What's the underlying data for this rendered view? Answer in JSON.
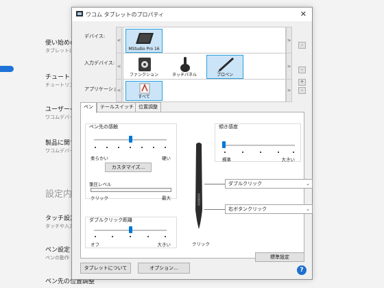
{
  "background": {
    "items": [
      {
        "title": "使い始めの",
        "sub": "タブレットに"
      },
      {
        "title": "チュートリア",
        "sub": "チュートリアル"
      },
      {
        "title": "ユーザーヘル",
        "sub": "ワコムデバイ"
      },
      {
        "title": "製品に関す",
        "sub": "ワコムデバイ"
      }
    ],
    "section_title": "設定内",
    "items2": [
      {
        "title": "タッチ設定",
        "sub": "タッチや入力"
      },
      {
        "title": "ペン設定",
        "sub": "ペンの動作"
      },
      {
        "title": "ペン先の位置調整",
        "sub": ""
      }
    ]
  },
  "dialog": {
    "title": "ワコム タブレットのプロパティ",
    "close_glyph": "✕",
    "device_label": "デバイス:",
    "input_device_label": "入力デバイス:",
    "application_label": "アプリケーション:",
    "devices": [
      "MStudio Pro 16"
    ],
    "input_devices": [
      {
        "label": "ファンクション",
        "selected": false
      },
      {
        "label": "タッチパネル",
        "selected": false
      },
      {
        "label": "プロペン",
        "selected": true
      }
    ],
    "applications": [
      {
        "label": "すべて",
        "selected": true
      }
    ],
    "arrow_left": "<",
    "arrow_right": ">",
    "minus": "-",
    "plus": "+",
    "tabs": [
      "ペン",
      "テールスイッチ",
      "位置調整"
    ],
    "active_tab": "ペン",
    "tip_feel": {
      "label": "ペン先の感触",
      "left": "柔らかい",
      "right": "硬い",
      "level": 0.5
    },
    "customize_button": "カスタマイズ...",
    "pressure": {
      "label": "筆圧レベル",
      "left": "クリック",
      "right": "最大"
    },
    "double_click": {
      "label": "ダブルクリック距離",
      "left": "オフ",
      "right": "大きい",
      "level": 0.5
    },
    "tilt": {
      "label": "傾き感度",
      "left": "標準",
      "right": "大きい",
      "level": 0.0
    },
    "upper_button": "ダブルクリック",
    "lower_button": "右ボタンクリック",
    "tip_label": "クリック",
    "default_button": "標準設定",
    "about_button": "タブレットについて",
    "options_button": "オプション...",
    "help_glyph": "?",
    "colors": {
      "accent": "#0078d7",
      "selection": "#cce4f7",
      "help": "#1f6fd0"
    }
  }
}
